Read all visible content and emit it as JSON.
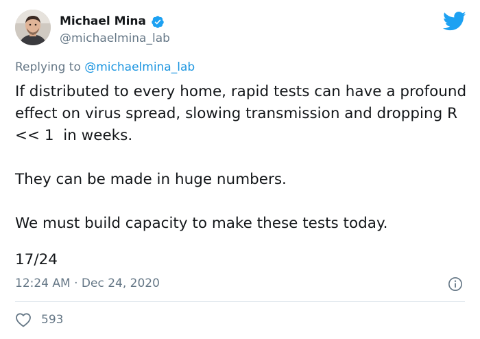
{
  "author": {
    "name": "Michael Mina",
    "handle": "@michaelmina_lab",
    "verified": true
  },
  "reply": {
    "prefix": "Replying to ",
    "mention": "@michaelmina_lab"
  },
  "tweet": {
    "paragraphs": [
      "If distributed to every home, rapid tests can have a profound effect on virus spread, slowing transmission and dropping R << 1  in weeks.",
      "They can be made in huge numbers.",
      "We must build capacity to make these tests today."
    ],
    "thread_position": "17/24",
    "timestamp": "12:24 AM · Dec 24, 2020",
    "likes": "593"
  },
  "icons": {
    "brand": "twitter-bird-icon",
    "verified": "verified-badge-icon",
    "info": "info-icon",
    "like": "heart-icon"
  },
  "colors": {
    "brand_blue": "#1da1f2",
    "link_blue": "#1b95e0",
    "secondary_text": "#657786",
    "primary_text": "#14171a",
    "divider": "#e1e8ed"
  }
}
